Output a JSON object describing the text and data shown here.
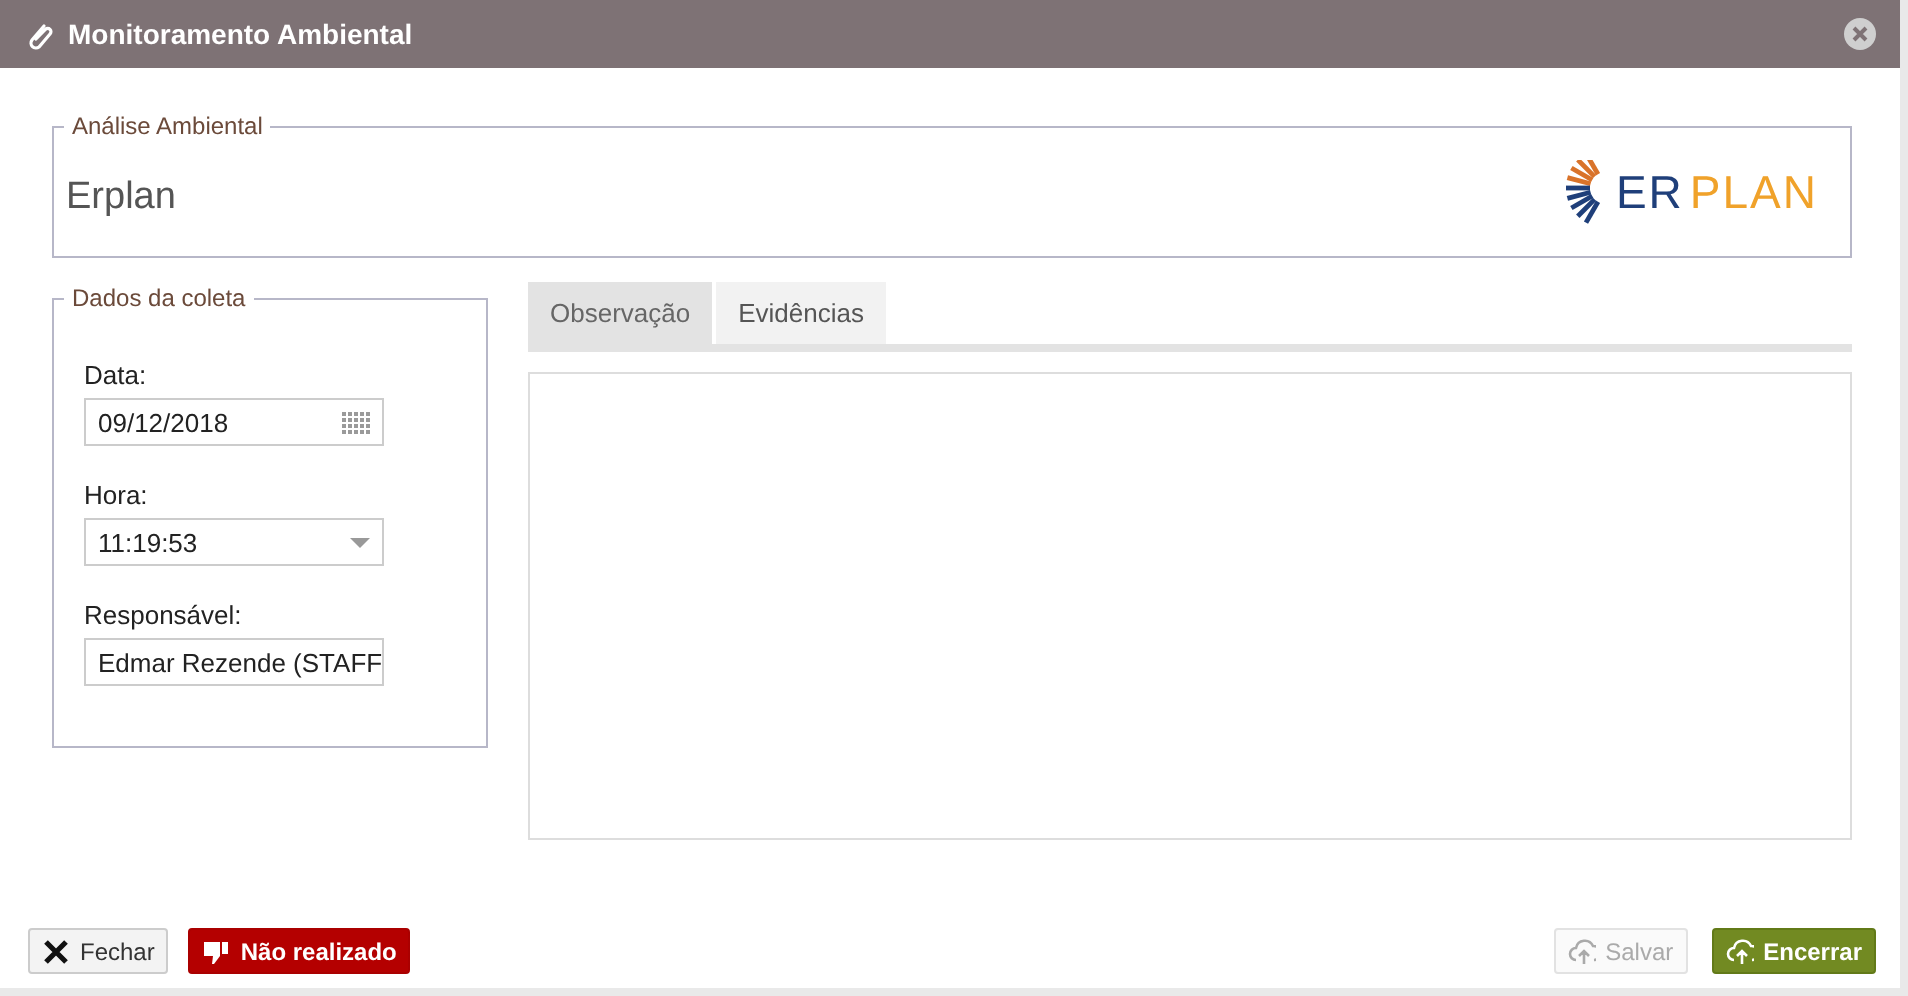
{
  "window": {
    "title": "Monitoramento Ambiental"
  },
  "header": {
    "legend": "Análise Ambiental",
    "company": "Erplan",
    "logo": {
      "part_1": "ER",
      "part_2": "PLAN"
    }
  },
  "form": {
    "legend": "Dados da coleta",
    "fields": [
      {
        "kind": "date",
        "label": "Data:",
        "value": "09/12/2018"
      },
      {
        "kind": "select",
        "label": "Hora:",
        "value": "11:19:53"
      },
      {
        "kind": "text",
        "label": "Responsável:",
        "value": "Edmar Rezende (STAFF"
      }
    ]
  },
  "tabs": [
    {
      "label": "Observação",
      "selected": true
    },
    {
      "label": "Evidências",
      "selected": false
    }
  ],
  "buttons": [
    {
      "kind": "close",
      "label": "Fechar",
      "disabled": false
    },
    {
      "kind": "danger",
      "label": "Não realizado",
      "disabled": false
    },
    {
      "kind": "save",
      "label": "Salvar",
      "disabled": true
    },
    {
      "kind": "finish",
      "label": "Encerrar",
      "disabled": false
    }
  ]
}
